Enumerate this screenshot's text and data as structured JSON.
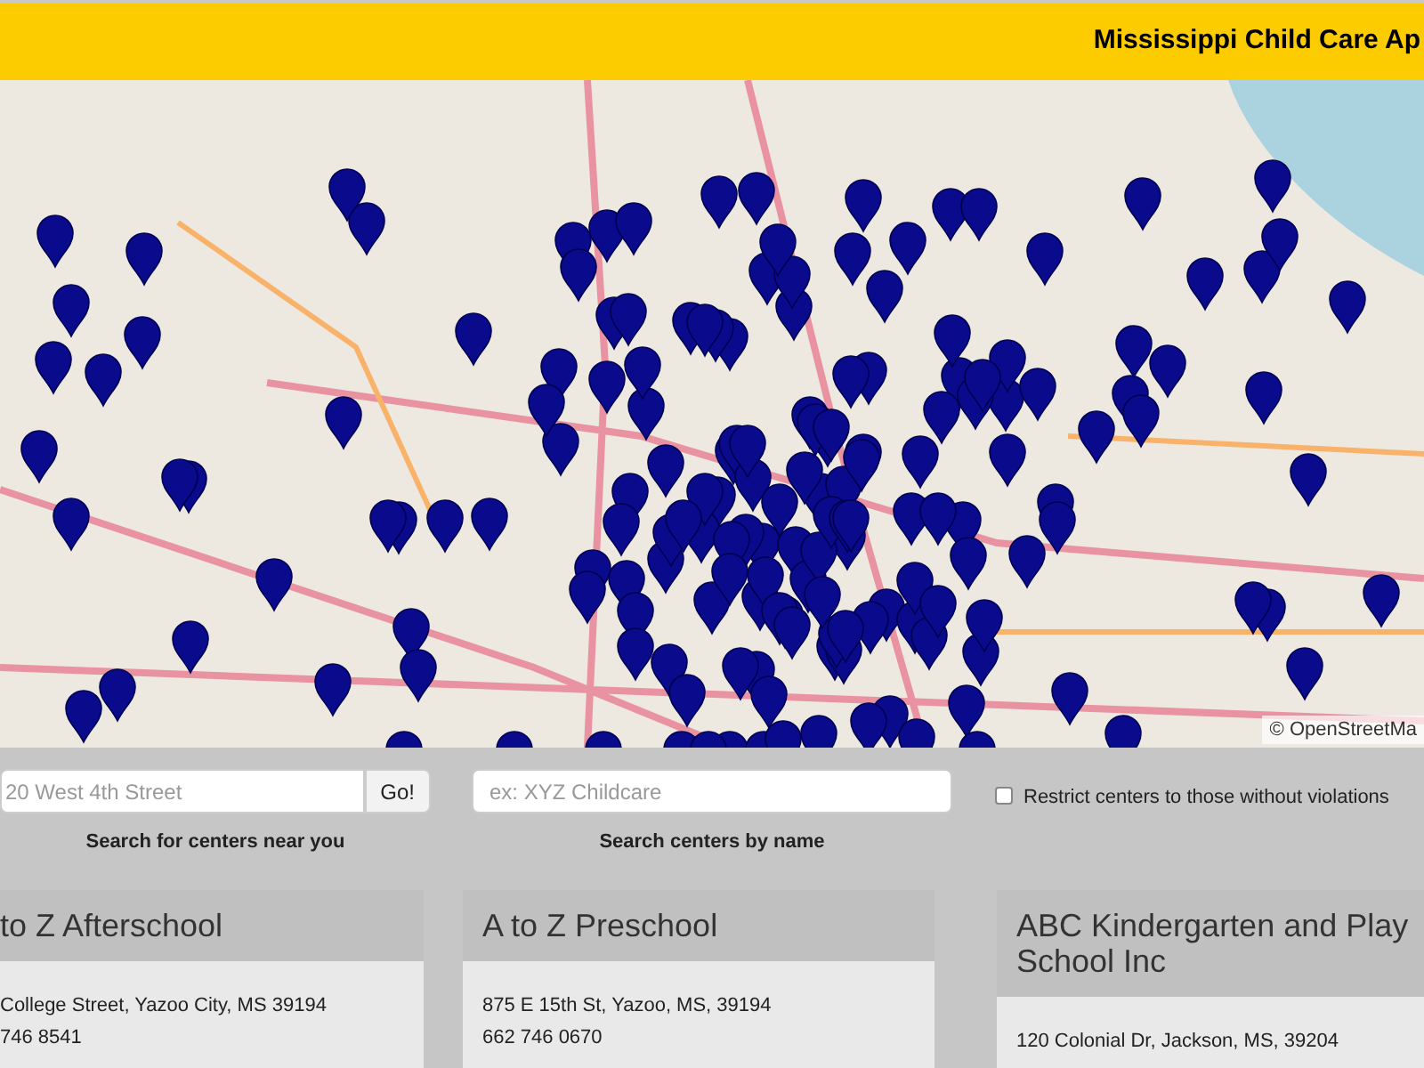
{
  "header": {
    "title": "Mississippi Child Care Ap"
  },
  "map": {
    "attribution": "© OpenStreetMa"
  },
  "search": {
    "address": {
      "placeholder": "20 West 4th Street",
      "button": "Go!",
      "caption": "Search for centers near you"
    },
    "name": {
      "placeholder": "ex: XYZ Childcare",
      "caption": "Search centers by name"
    },
    "restrict": {
      "label": "Restrict centers to those without violations",
      "checked": false
    }
  },
  "centers": [
    {
      "name": "to Z Afterschool",
      "address": "College Street, Yazoo City, MS 39194",
      "phone": "746 8541"
    },
    {
      "name": "A to Z Preschool",
      "address": "875 E 15th St, Yazoo, MS, 39194",
      "phone": "662 746 0670"
    },
    {
      "name": "ABC Kindergarten and Play School Inc",
      "address": "120 Colonial Dr, Jackson, MS, 39204"
    }
  ]
}
